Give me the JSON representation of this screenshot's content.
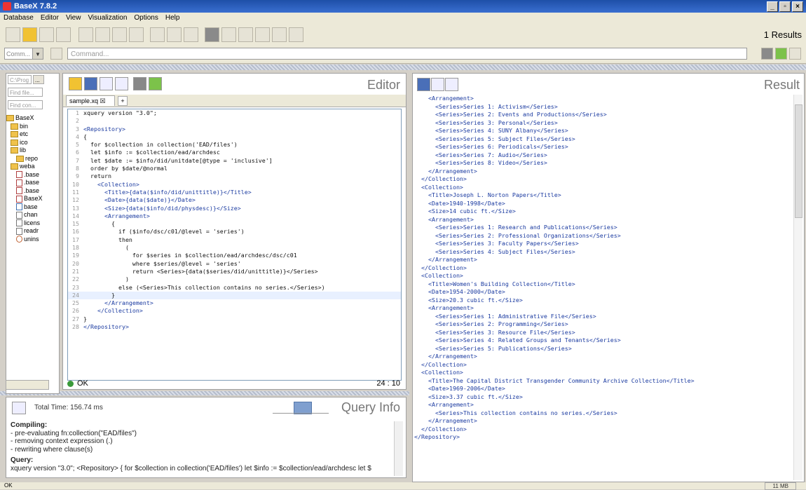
{
  "window": {
    "title": "BaseX 7.8.2"
  },
  "menu": [
    "Database",
    "Editor",
    "View",
    "Visualization",
    "Options",
    "Help"
  ],
  "toolbar": {
    "results": "1 Results"
  },
  "command": {
    "mode": "Comm...",
    "placeholder": "Command..."
  },
  "files": {
    "path": "C:\\Prog",
    "browse": "...",
    "find_file": "Find file...",
    "find_content": "Find con...",
    "tree": [
      "BaseX",
      "bin",
      "etc",
      "ico",
      "lib",
      "repo",
      "weba",
      ".base",
      ".base",
      ".base",
      "BaseX",
      "base",
      "chan",
      "licens",
      "readr",
      "unins"
    ]
  },
  "editor": {
    "title": "Editor",
    "tab": "sample.xq",
    "status": "OK",
    "cursor": "24 : 10",
    "lines": [
      "xquery version \"3.0\";",
      "",
      "<Repository>",
      "{",
      "  for $collection in collection('EAD/files')",
      "  let $info := $collection/ead/archdesc",
      "  let $date := $info/did/unitdate[@type = 'inclusive']",
      "  order by $date/@normal",
      "  return",
      "    <Collection>",
      "      <Title>{data($info/did/unittitle)}</Title>",
      "      <Date>{data($date)}</Date>",
      "      <Size>{data($info/did/physdesc)}</Size>",
      "      <Arrangement>",
      "        {",
      "          if ($info/dsc/c01/@level = 'series')",
      "          then",
      "            (",
      "              for $series in $collection/ead/archdesc/dsc/c01",
      "              where $series/@level = 'series'",
      "              return <Series>{data($series/did/unittitle)}</Series>",
      "            )",
      "          else (<Series>This collection contains no series.</Series>)",
      "        }",
      "      </Arrangement>",
      "    </Collection>",
      "}",
      "</Repository>"
    ]
  },
  "queryinfo": {
    "title": "Query Info",
    "total_time": "Total Time: 156.74 ms",
    "lines": [
      "Compiling:",
      "- pre-evaluating fn:collection(\"EAD/files\")",
      "- removing context expression (.)",
      "- rewriting where clause(s)",
      "Query:",
      "xquery version \"3.0\"; <Repository> { for $collection in collection('EAD/files') let $info := $collection/ead/archdesc let $"
    ]
  },
  "result": {
    "title": "Result",
    "lines": [
      "    <Arrangement>",
      "      <Series>Series 1: Activism</Series>",
      "      <Series>Series 2: Events and Productions</Series>",
      "      <Series>Series 3: Personal</Series>",
      "      <Series>Series 4: SUNY Albany</Series>",
      "      <Series>Series 5: Subject Files</Series>",
      "      <Series>Series 6: Periodicals</Series>",
      "      <Series>Series 7: Audio</Series>",
      "      <Series>Series 8: Video</Series>",
      "    </Arrangement>",
      "  </Collection>",
      "  <Collection>",
      "    <Title>Joseph L. Norton Papers</Title>",
      "    <Date>1940-1998</Date>",
      "    <Size>14 cubic ft.</Size>",
      "    <Arrangement>",
      "      <Series>Series 1: Research and Publications</Series>",
      "      <Series>Series 2: Professional Organizations</Series>",
      "      <Series>Series 3: Faculty Papers</Series>",
      "      <Series>Series 4: Subject Files</Series>",
      "    </Arrangement>",
      "  </Collection>",
      "  <Collection>",
      "    <Title>Women's Building Collection</Title>",
      "    <Date>1954-2000</Date>",
      "    <Size>20.3 cubic ft.</Size>",
      "    <Arrangement>",
      "      <Series>Series 1: Administrative File</Series>",
      "      <Series>Series 2: Programming</Series>",
      "      <Series>Series 3: Resource File</Series>",
      "      <Series>Series 4: Related Groups and Tenants</Series>",
      "      <Series>Series 5: Publications</Series>",
      "    </Arrangement>",
      "  </Collection>",
      "  <Collection>",
      "    <Title>The Capital District Transgender Community Archive Collection</Title>",
      "    <Date>1969-2006</Date>",
      "    <Size>3.37 cubic ft.</Size>",
      "    <Arrangement>",
      "      <Series>This collection contains no series.</Series>",
      "    </Arrangement>",
      "  </Collection>",
      "</Repository>"
    ]
  },
  "statusbar": {
    "left": "OK",
    "memory": "11 MB"
  }
}
